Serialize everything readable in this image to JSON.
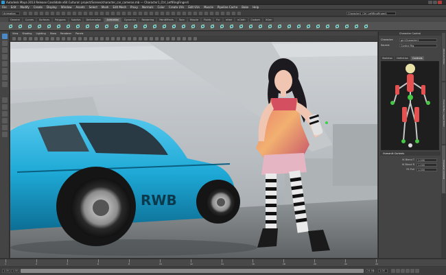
{
  "window": {
    "title": "Autodesk Maya 2013 Release Candidate x64 Cultural: project/Scenes/character_car_cameras.mb --- Character1_Ctrl_LeftRingFinger4"
  },
  "menubar": [
    "File",
    "Edit",
    "Modify",
    "Create",
    "Display",
    "Window",
    "Assets",
    "Select",
    "Mesh",
    "Edit Mesh",
    "Proxy",
    "Normals",
    "Color",
    "Create UVs",
    "Edit UVs",
    "Muscle",
    "Pipeline Cache",
    "Bake",
    "Help"
  ],
  "statusline": {
    "mode": "Animation",
    "field_right": "Character1_Ctrl_LeftRingFinger4"
  },
  "shelf_tabs": [
    "General",
    "Curves",
    "Surfaces",
    "Polygons",
    "Subdivs",
    "Deformation",
    "Animation",
    "Dynamics",
    "Rendering",
    "PaintEffects",
    "Toon",
    "Muscle",
    "Fluids",
    "Fur",
    "nHair",
    "nCloth",
    "Custom",
    "XGen"
  ],
  "shelf_active": "Animation",
  "viewport": {
    "menu": [
      "View",
      "Shading",
      "Lighting",
      "Show",
      "Renderer",
      "Panels"
    ]
  },
  "right_panel": {
    "header": "Character Control",
    "character_label": "Character:",
    "character_value": "girl:Character1",
    "source_label": "Source:",
    "source_value": "Control Rig",
    "tabs": [
      "Skeleton",
      "Definition",
      "Controls"
    ],
    "active_tab": "Controls",
    "section_title": "Humanik Controls",
    "attrs": [
      {
        "label": "IK Blend T",
        "value": "1.000"
      },
      {
        "label": "IK Blend R",
        "value": "1.000"
      },
      {
        "label": "FK Pull",
        "value": "1.000"
      }
    ]
  },
  "side_tabs": [
    "Attribute Editor",
    "Channel Box / Layer Editor",
    "Character Controls"
  ],
  "timeline": {
    "ticks": [
      "1",
      "2",
      "4",
      "6",
      "8",
      "10",
      "12",
      "14",
      "16",
      "18",
      "20",
      "22",
      "24"
    ]
  },
  "range": {
    "start": "1.00",
    "end": "24.00",
    "current": "1.00"
  },
  "colors": {
    "car_body": "#1ea9d6",
    "viewport_bg": "#cfd3d6",
    "selection_blue": "#4a88c7"
  }
}
